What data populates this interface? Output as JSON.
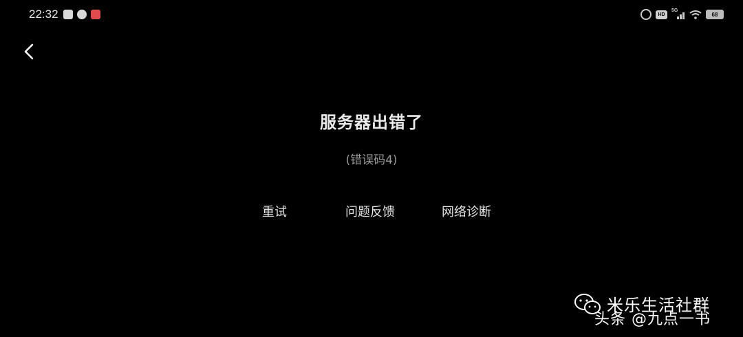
{
  "status_bar": {
    "time": "22:32",
    "network": "5G",
    "hd": "HD",
    "battery": "68"
  },
  "nav": {
    "back_icon": "chevron-left-icon"
  },
  "error": {
    "title": "服务器出错了",
    "code": "(错误码4)"
  },
  "actions": {
    "retry": "重试",
    "feedback": "问题反馈",
    "diagnose": "网络诊断"
  },
  "watermark": {
    "line1": "米乐生活社群",
    "line2": "头条 @九点一书"
  }
}
